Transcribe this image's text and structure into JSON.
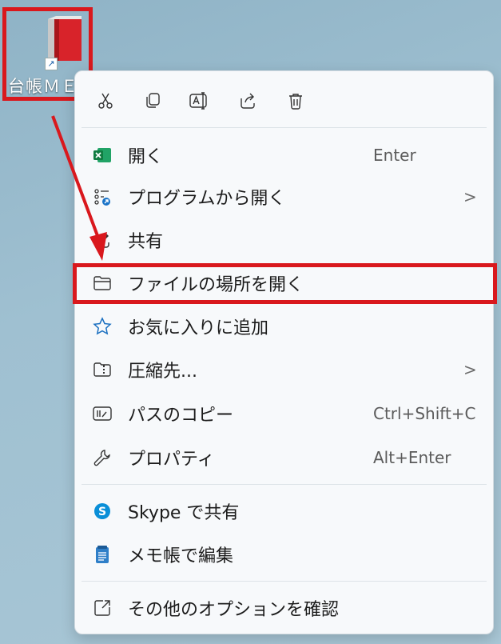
{
  "desktop_icon": {
    "label": "台帳ＭＥ",
    "name": "book-shortcut-icon"
  },
  "toolbar": [
    {
      "name": "cut-icon"
    },
    {
      "name": "copy-icon"
    },
    {
      "name": "rename-icon"
    },
    {
      "name": "share-icon"
    },
    {
      "name": "delete-icon"
    }
  ],
  "menu": {
    "items": [
      {
        "label": "開く",
        "shortcut": "Enter",
        "icon": "excel-icon"
      },
      {
        "label": "プログラムから開く",
        "shortcut": "",
        "icon": "open-with-icon",
        "submenu": true
      },
      {
        "label": "共有",
        "shortcut": "",
        "icon": "share-icon"
      },
      {
        "label": "ファイルの場所を開く",
        "shortcut": "",
        "icon": "folder-icon"
      },
      {
        "label": "お気に入りに追加",
        "shortcut": "",
        "icon": "star-icon"
      },
      {
        "label": "圧縮先...",
        "shortcut": "",
        "icon": "zip-folder-icon",
        "submenu": true
      },
      {
        "label": "パスのコピー",
        "shortcut": "Ctrl+Shift+C",
        "icon": "copy-path-icon"
      },
      {
        "label": "プロパティ",
        "shortcut": "Alt+Enter",
        "icon": "wrench-icon"
      },
      {
        "label": "Skype で共有",
        "shortcut": "",
        "icon": "skype-icon"
      },
      {
        "label": "メモ帳で編集",
        "shortcut": "",
        "icon": "notepad-icon"
      },
      {
        "label": "その他のオプションを確認",
        "shortcut": "",
        "icon": "more-options-icon"
      }
    ],
    "chevron": ">"
  },
  "colors": {
    "highlight": "#d9181d",
    "menu_bg": "#f7f9fb"
  }
}
